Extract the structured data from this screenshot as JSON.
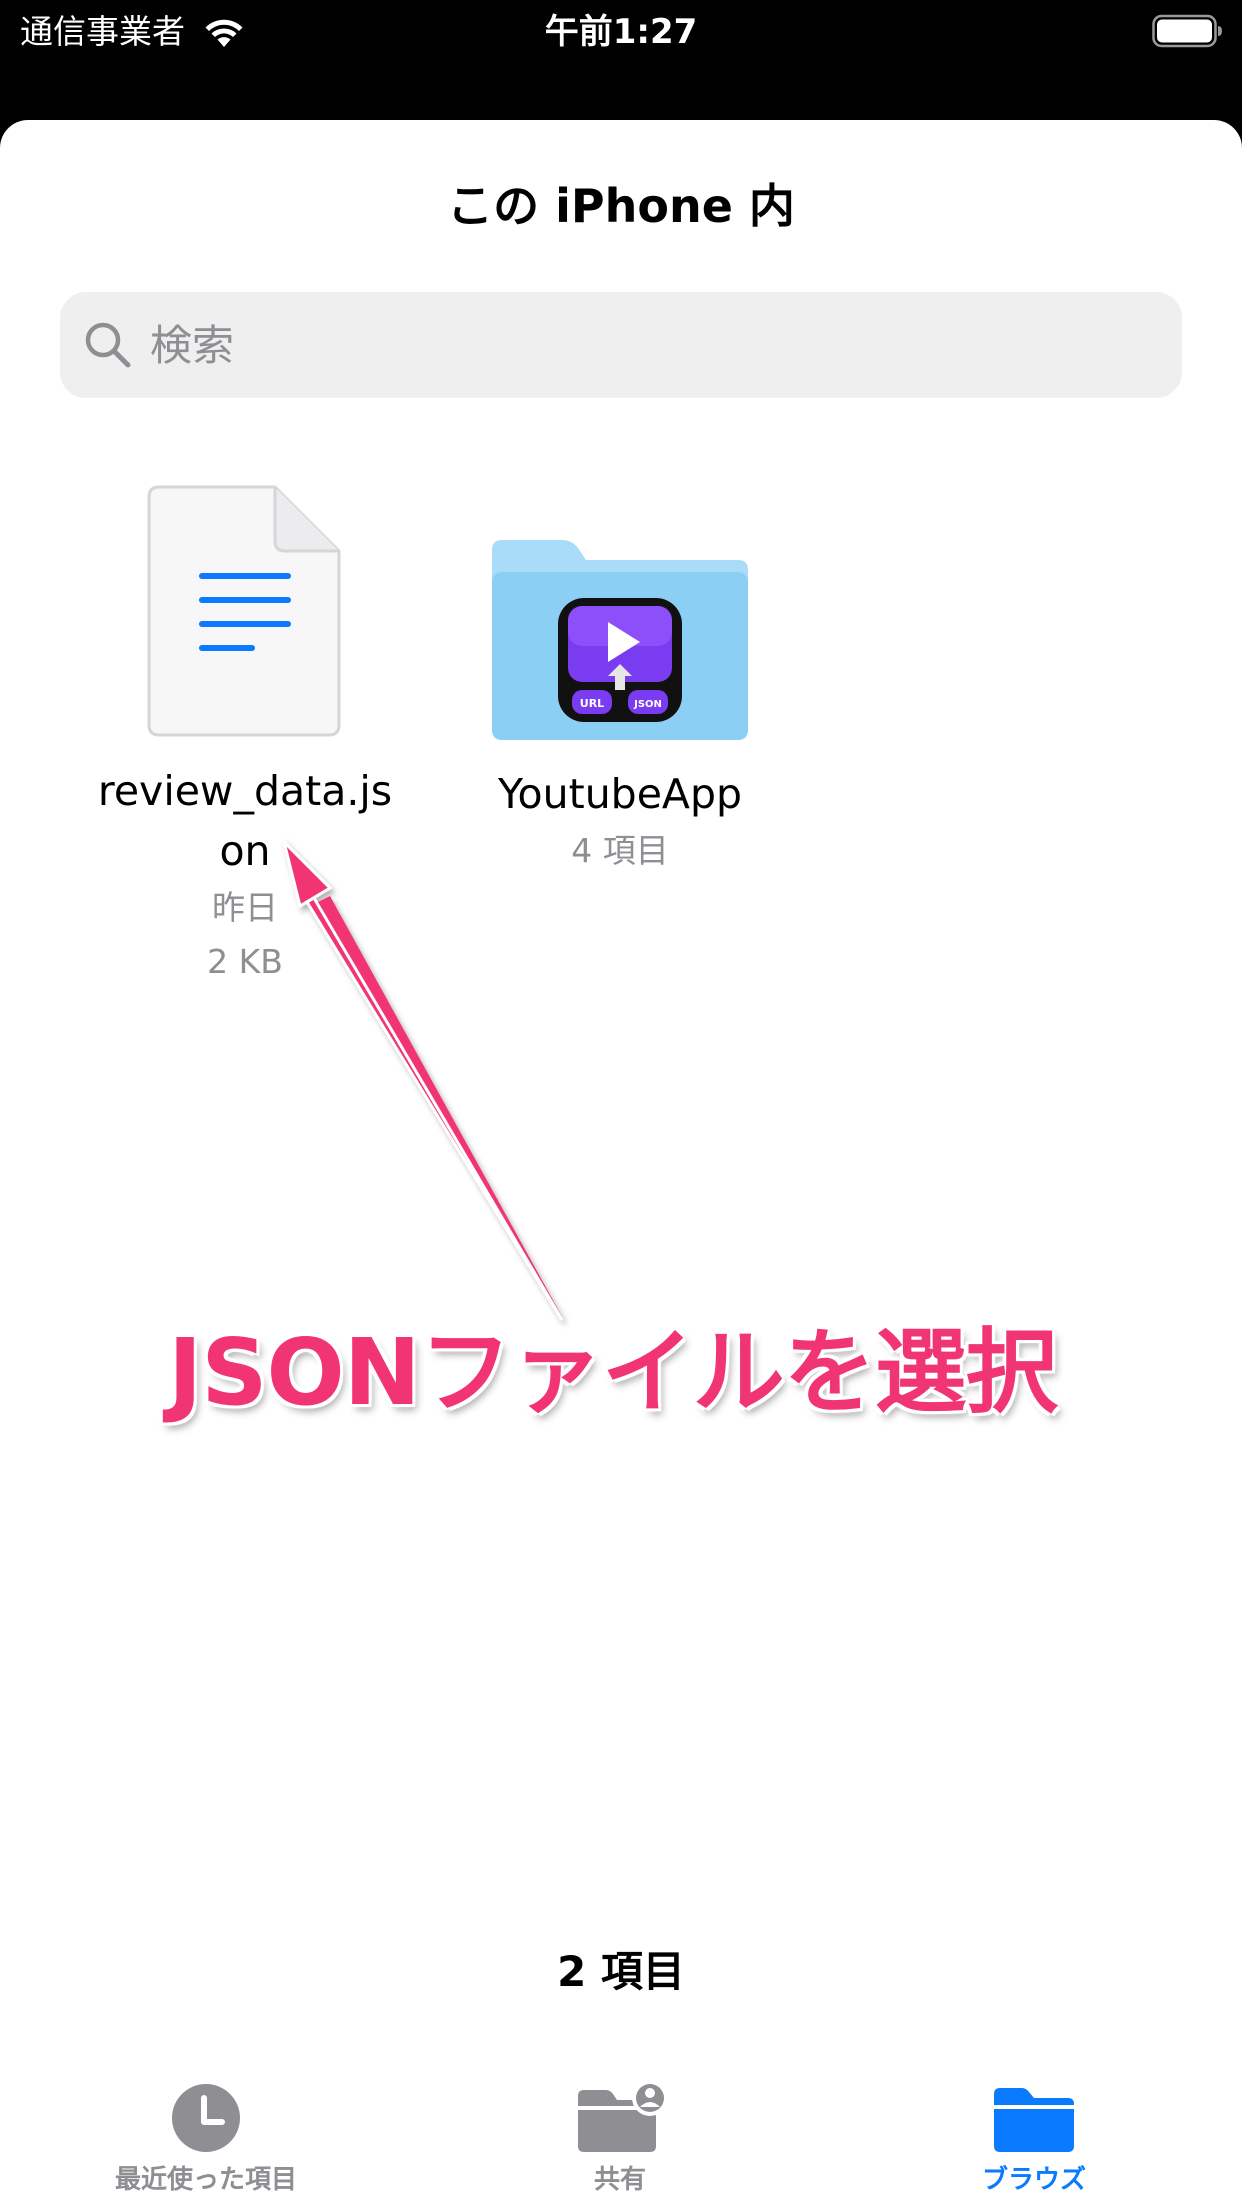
{
  "status_bar": {
    "carrier": "通信事業者",
    "time": "午前1:27"
  },
  "header": {
    "title": "この iPhone 内"
  },
  "search": {
    "placeholder": "検索"
  },
  "items": [
    {
      "name": "review_data.json",
      "date": "昨日",
      "size": "2 KB",
      "icon": "document-icon"
    },
    {
      "name": "YoutubeApp",
      "count": "4 項目",
      "icon": "folder-icon",
      "badge_left": "URL",
      "badge_right": "JSON"
    }
  ],
  "annotation": {
    "text": "JSONファイルを選択",
    "color": "#f13473"
  },
  "footer": {
    "item_count": "2 項目"
  },
  "tab_bar": {
    "tabs": [
      {
        "label": "最近使った項目",
        "icon": "clock-icon",
        "active": false
      },
      {
        "label": "共有",
        "icon": "shared-folder-icon",
        "active": false
      },
      {
        "label": "ブラウズ",
        "icon": "folder-icon",
        "active": true
      }
    ],
    "active_color": "#0a7bff",
    "inactive_color": "#8e8e93"
  }
}
